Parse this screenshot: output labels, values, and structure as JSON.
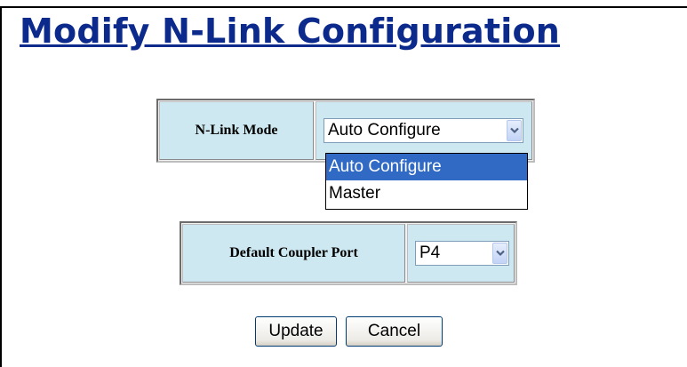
{
  "page": {
    "title": "Modify N-Link Configuration"
  },
  "nlink_mode": {
    "label": "N-Link Mode",
    "selected_value": "Auto Configure",
    "options": [
      "Auto Configure",
      "Master"
    ]
  },
  "coupler_port": {
    "label": "Default Coupler Port",
    "selected_value": "P4"
  },
  "buttons": {
    "update": "Update",
    "cancel": "Cancel"
  },
  "colors": {
    "title": "#0b2a8c",
    "cell_background": "#cde8f0",
    "selection": "#316ac5",
    "button_border": "#003c74"
  },
  "icons": {
    "select_arrow": "chevron-down-icon"
  }
}
